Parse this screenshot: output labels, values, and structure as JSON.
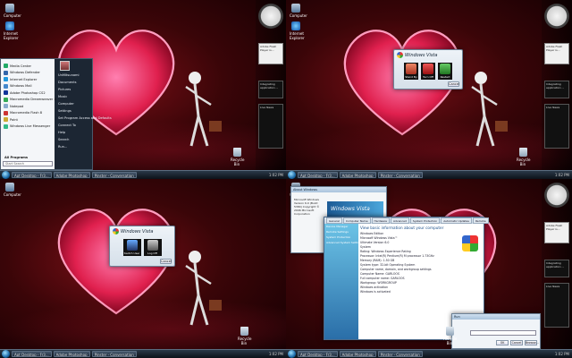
{
  "desktop": {
    "icon_computer": "Computer",
    "icon_ie": "Internet Explorer",
    "icon_recycle": "Recycle Bin"
  },
  "taskbar": {
    "btn1": "Apt Desktop - Fr3...",
    "btn2": "Adobe Photoshop",
    "btn3": "Pinster - Conversation",
    "tray": "1:02 PM"
  },
  "sidebar": {
    "gadget1": "Adobe Flash Player is...",
    "gadget2": "Integrating application ...",
    "gadget3": "Live News"
  },
  "startmenu": {
    "items": [
      "Media Center",
      "Windows Defender",
      "Internet Explorer",
      "Windows Mail",
      "Adobe Photoshop CS2",
      "Macromedia Dreamweaver 8",
      "Notepad",
      "Macromedia Flash 8",
      "Paint",
      "Windows Live Messenger"
    ],
    "all_programs": "All Programs",
    "search_placeholder": "Start Search",
    "right": [
      "UnMitsunami",
      "Documents",
      "Pictures",
      "Music",
      "Computer",
      "Settings",
      "Set Program Access and Defaults",
      "Connect To",
      "Help",
      "Search",
      "Run..."
    ]
  },
  "dialog_shutdown": {
    "title": "Windows Vista",
    "opt1": "Stand By",
    "opt2": "Turn Off",
    "opt3": "Restart",
    "cancel": "Cancel"
  },
  "dialog_logoff": {
    "title": "Windows Vista",
    "opt1": "Switch User",
    "opt2": "Log Off",
    "cancel": "Cancel"
  },
  "about": {
    "title": "About Windows",
    "banner": "Windows Vista",
    "text": "Microsoft Windows Version 6.0 (Build 5384) Copyright © 2006 Microsoft Corporation"
  },
  "sysprop": {
    "tabs": [
      "General",
      "Computer Name",
      "Hardware",
      "Advanced",
      "System Protection",
      "Automatic Updates",
      "Remote"
    ],
    "links": [
      "Device Manager",
      "Remote Settings",
      "System Protection",
      "Advanced System Settings"
    ],
    "heading": "View basic information about your computer",
    "rows": [
      "Windows Edition",
      "Microsoft Windows Vista™",
      "Ultimate Version 6.0",
      "System",
      "Rating: Windows Experience Rating",
      "Processor: Intel(R) Pentium(R) M processor 1.73GHz",
      "Memory (RAM): 1.50 GB",
      "System type: 32-bit Operating System",
      "Computer name, domain, and workgroup settings",
      "Computer Name: GARLOOS",
      "Full computer name: GARLOOS",
      "Workgroup: WORKGROUP",
      "Windows activation",
      "Windows is activated"
    ]
  },
  "run": {
    "title": "Run",
    "ok": "OK",
    "cancel": "Cancel",
    "browse": "Browse..."
  }
}
